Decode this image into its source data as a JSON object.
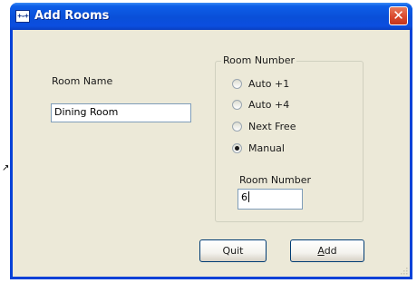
{
  "window": {
    "title": "Add Rooms",
    "icon_text": "+-+",
    "close_glyph": "✕"
  },
  "room_name": {
    "label": "Room Name",
    "value": "Dining Room"
  },
  "room_number_group": {
    "caption": "Room Number",
    "options": [
      {
        "label": "Auto +1",
        "checked": false
      },
      {
        "label": "Auto +4",
        "checked": false
      },
      {
        "label": "Next Free",
        "checked": false
      },
      {
        "label": "Manual",
        "checked": true
      }
    ],
    "field_label": "Room Number",
    "field_value": "6"
  },
  "buttons": {
    "quit": "Quit",
    "add_first": "A",
    "add_rest": "dd"
  },
  "colors": {
    "titlebar": "#0a4fd8",
    "client_bg": "#ece9d8",
    "close": "#d8462a"
  }
}
